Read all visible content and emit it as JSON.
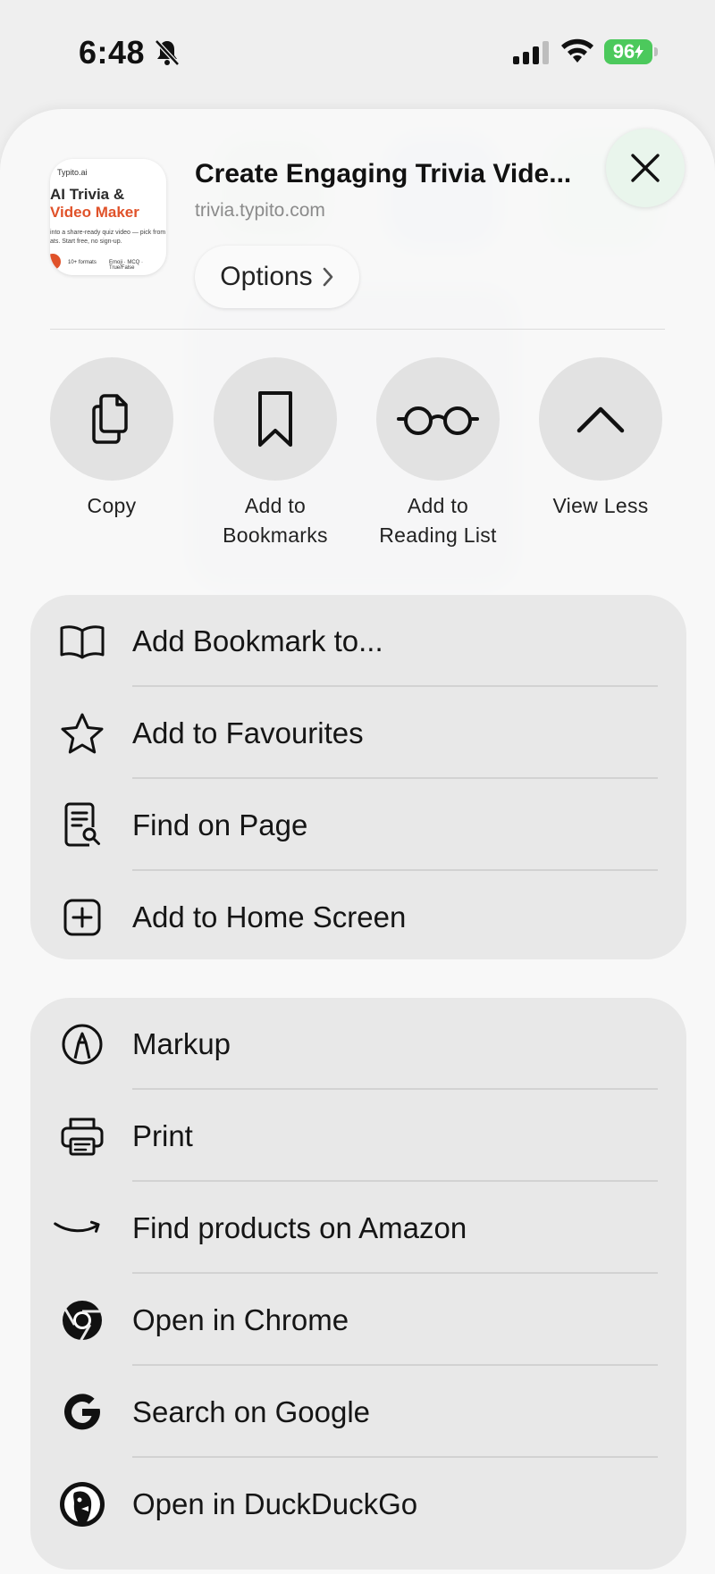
{
  "status_bar": {
    "time": "6:48",
    "battery": "96"
  },
  "preview": {
    "thumbnail": {
      "brand": "Typito.ai",
      "title_line1": "AI Trivia &",
      "title_line2": "Video Maker",
      "tagline": "into a share-ready quiz video — pick from ats. Start free, no sign-up.",
      "chip1": "10+ formats",
      "chip2": "Emoji · MCQ · True/False"
    },
    "title": "Create Engaging Trivia Vide...",
    "url": "trivia.typito.com",
    "options_label": "Options"
  },
  "actions": [
    {
      "label_line1": "Copy",
      "label_line2": "",
      "icon": "copy-icon"
    },
    {
      "label_line1": "Add to",
      "label_line2": "Bookmarks",
      "icon": "bookmark-icon"
    },
    {
      "label_line1": "Add to",
      "label_line2": "Reading List",
      "icon": "glasses-icon"
    },
    {
      "label_line1": "View Less",
      "label_line2": "",
      "icon": "chevron-up-icon"
    }
  ],
  "group1": [
    {
      "label": "Add Bookmark to...",
      "icon": "book-icon"
    },
    {
      "label": "Add to Favourites",
      "icon": "star-icon"
    },
    {
      "label": "Find on Page",
      "icon": "find-page-icon"
    },
    {
      "label": "Add to Home Screen",
      "icon": "plus-square-icon"
    }
  ],
  "group2": [
    {
      "label": "Markup",
      "icon": "markup-icon"
    },
    {
      "label": "Print",
      "icon": "printer-icon"
    },
    {
      "label": "Find products on Amazon",
      "icon": "amazon-icon"
    },
    {
      "label": "Open in Chrome",
      "icon": "chrome-icon"
    },
    {
      "label": "Search on Google",
      "icon": "google-icon"
    },
    {
      "label": "Open in DuckDuckGo",
      "icon": "duckduckgo-icon"
    }
  ],
  "colors": {
    "battery": "#4cc95c",
    "close_button": "#e9f5ec",
    "sheet": "#f8f8f8",
    "group": "#e8e8e8"
  }
}
